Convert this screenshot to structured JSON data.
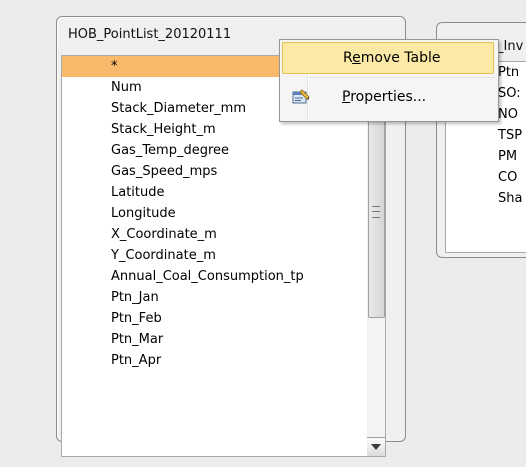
{
  "table1": {
    "title": "HOB_PointList_20120111",
    "fields": [
      "*",
      "Num",
      "Stack_Diameter_mm",
      "Stack_Height_m",
      "Gas_Temp_degree",
      "Gas_Speed_mps",
      "Latitude",
      "Longitude",
      "X_Coordinate_m",
      "Y_Coordinate_m",
      "Annual_Coal_Consumption_tp",
      "Ptn_Jan",
      "Ptn_Feb",
      "Ptn_Mar",
      "Ptn_Apr"
    ],
    "selected_index": 0
  },
  "table2": {
    "title": "_Inv",
    "fields": [
      "Ptn",
      "SO:",
      "NO",
      "TSP",
      "PM",
      "CO",
      "Sha"
    ]
  },
  "context_menu": {
    "remove_table": {
      "prefix": "R",
      "underline": "e",
      "rest": "move Table"
    },
    "properties": {
      "underline": "P",
      "rest": "roperties..."
    }
  }
}
